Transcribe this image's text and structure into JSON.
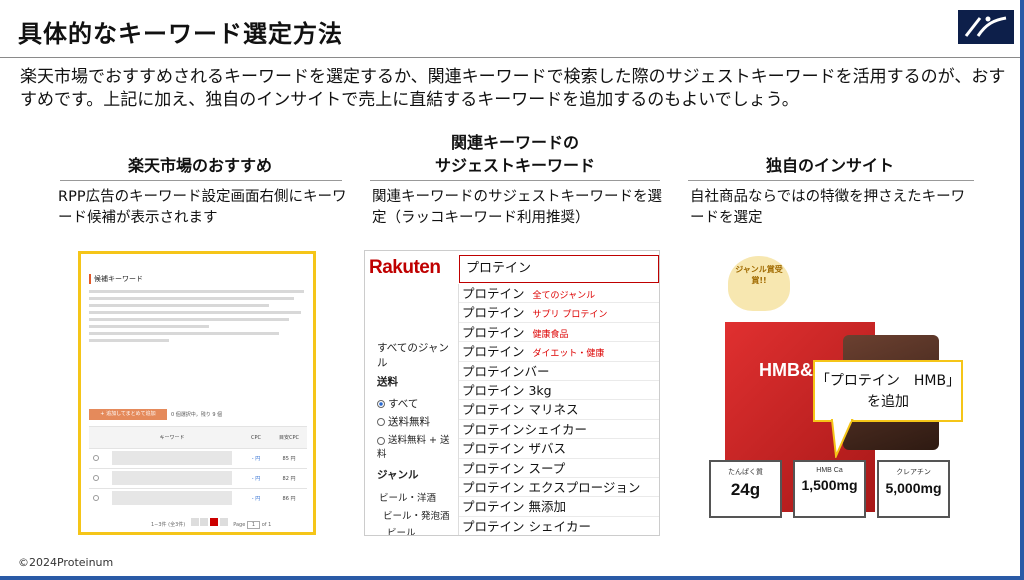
{
  "title": "具体的なキーワード選定方法",
  "intro": "楽天市場でおすすめされるキーワードを選定するか、関連キーワードで検索した際のサジェストキーワードを活用するのが、おすすめです。上記に加え、独自のインサイトで売上に直結するキーワードを追加するのもよいでしょう。",
  "columns": [
    {
      "heading": "楽天市場のおすすめ",
      "text": "RPP広告のキーワード設定画面右側にキーワード候補が表示されます"
    },
    {
      "heading_line1": "関連キーワードの",
      "heading_line2": "サジェストキーワード",
      "text": "関連キーワードのサジェストキーワードを選定（ラッコキーワード利用推奨）"
    },
    {
      "heading": "独自のインサイト",
      "text": "自社商品ならではの特徴を押さえたキーワードを選定"
    }
  ],
  "rpp": {
    "panel_title": "候補キーワード",
    "add_button": "+ 追加してまとめて追加",
    "count": "0 個選択中，残り 9 個",
    "col_keyword": "キーワード",
    "col_cpc": "CPC",
    "col_target_cpc": "目安CPC",
    "rows": [
      {
        "cpc": "- 円",
        "target": "85 円"
      },
      {
        "cpc": "- 円",
        "target": "82 円"
      },
      {
        "cpc": "- 円",
        "target": "86 円"
      }
    ],
    "footer": "1−3件 (全3件)",
    "page_label": "Page",
    "page_value": "1",
    "page_of": "of 1"
  },
  "rakuten": {
    "logo": "Rakuten",
    "search_value": "プロテイン",
    "side_all_genres": "すべてのジャンル",
    "side_shipping": "送料",
    "radio_all": "すべて",
    "radio_free": "送料無料",
    "radio_free_plus": "送料無料 + 送料",
    "side_genre": "ジャンル",
    "side_genre_1": "ビール・洋酒",
    "side_genre_2": "ビール・発泡酒",
    "side_genre_3": "ビール",
    "suggestions": [
      {
        "text": "プロテイン",
        "sub": "全てのジャンル"
      },
      {
        "text": "プロテイン",
        "sub": "サプリ プロテイン"
      },
      {
        "text": "プロテイン",
        "sub": "健康食品"
      },
      {
        "text": "プロテイン",
        "sub": "ダイエット・健康"
      },
      {
        "text": "プロテインバー",
        "sub": ""
      },
      {
        "text": "プロテイン 3kg",
        "sub": ""
      },
      {
        "text": "プロテイン マリネス",
        "sub": ""
      },
      {
        "text": "プロテインシェイカー",
        "sub": ""
      },
      {
        "text": "プロテイン ザバス",
        "sub": ""
      },
      {
        "text": "プロテイン スープ",
        "sub": ""
      },
      {
        "text": "プロテイン エクスプロージョン",
        "sub": ""
      },
      {
        "text": "プロテイン 無添加",
        "sub": ""
      },
      {
        "text": "プロテイン シェイカー",
        "sub": ""
      }
    ]
  },
  "insight": {
    "badge": "ジャンル賞受賞!!",
    "package": "HMB&CR",
    "boxes": [
      {
        "label": "たんぱく質",
        "value": "24g"
      },
      {
        "label": "HMB Ca",
        "value": "1,500mg"
      },
      {
        "label": "クレアチン",
        "value": "5,000mg"
      }
    ],
    "callout_line1": "「プロテイン　HMB」",
    "callout_line2": "を追加"
  },
  "copyright": "©2024Proteinum",
  "colors": {
    "accent": "#f5c518",
    "rakuten_red": "#bf0000",
    "frame_blue": "#2a5aa6"
  }
}
